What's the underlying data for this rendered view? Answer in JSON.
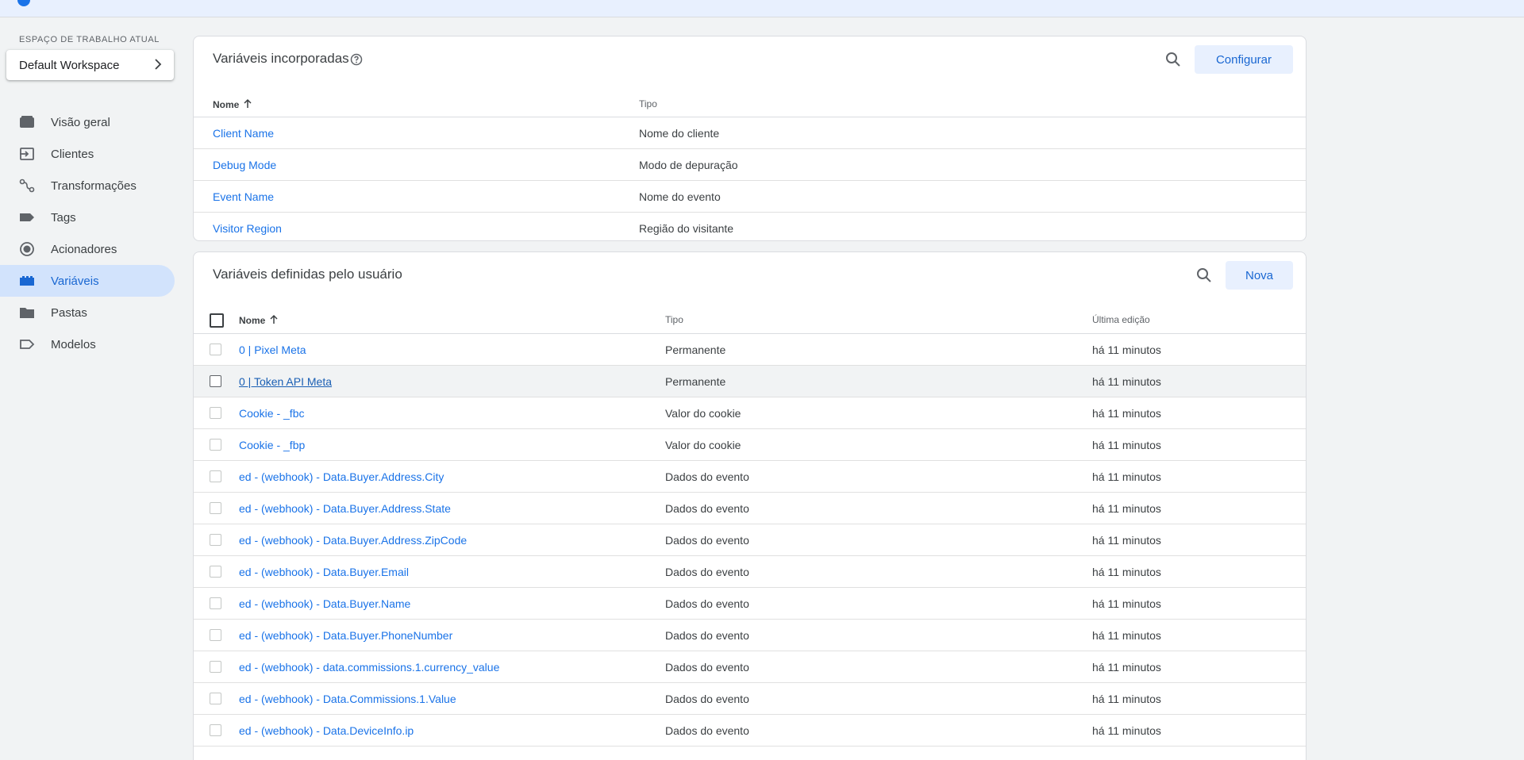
{
  "sidebar": {
    "workspace_label": "ESPAÇO DE TRABALHO ATUAL",
    "workspace_name": "Default Workspace",
    "items": [
      {
        "label": "Visão geral",
        "icon": "overview-icon"
      },
      {
        "label": "Clientes",
        "icon": "clients-icon"
      },
      {
        "label": "Transformações",
        "icon": "transformations-icon"
      },
      {
        "label": "Tags",
        "icon": "tag-icon"
      },
      {
        "label": "Acionadores",
        "icon": "triggers-icon"
      },
      {
        "label": "Variáveis",
        "icon": "variables-icon",
        "active": true
      },
      {
        "label": "Pastas",
        "icon": "folder-icon"
      },
      {
        "label": "Modelos",
        "icon": "templates-icon"
      }
    ]
  },
  "builtin": {
    "title": "Variáveis incorporadas",
    "configure_label": "Configurar",
    "columns": {
      "name": "Nome",
      "type": "Tipo"
    },
    "rows": [
      {
        "name": "Client Name",
        "type": "Nome do cliente"
      },
      {
        "name": "Debug Mode",
        "type": "Modo de depuração"
      },
      {
        "name": "Event Name",
        "type": "Nome do evento"
      },
      {
        "name": "Visitor Region",
        "type": "Região do visitante"
      }
    ]
  },
  "user": {
    "title": "Variáveis definidas pelo usuário",
    "new_label": "Nova",
    "columns": {
      "name": "Nome",
      "type": "Tipo",
      "edited": "Última edição"
    },
    "rows": [
      {
        "name": "0 | Pixel Meta",
        "type": "Permanente",
        "edited": "há 11 minutos"
      },
      {
        "name": "0 | Token API Meta",
        "type": "Permanente",
        "edited": "há 11 minutos"
      },
      {
        "name": "Cookie - _fbc",
        "type": "Valor do cookie",
        "edited": "há 11 minutos"
      },
      {
        "name": "Cookie - _fbp",
        "type": "Valor do cookie",
        "edited": "há 11 minutos"
      },
      {
        "name": "ed - (webhook) - Data.Buyer.Address.City",
        "type": "Dados do evento",
        "edited": "há 11 minutos"
      },
      {
        "name": "ed - (webhook) - Data.Buyer.Address.State",
        "type": "Dados do evento",
        "edited": "há 11 minutos"
      },
      {
        "name": "ed - (webhook) - Data.Buyer.Address.ZipCode",
        "type": "Dados do evento",
        "edited": "há 11 minutos"
      },
      {
        "name": "ed - (webhook) - Data.Buyer.Email",
        "type": "Dados do evento",
        "edited": "há 11 minutos"
      },
      {
        "name": "ed - (webhook) - Data.Buyer.Name",
        "type": "Dados do evento",
        "edited": "há 11 minutos"
      },
      {
        "name": "ed - (webhook) - Data.Buyer.PhoneNumber",
        "type": "Dados do evento",
        "edited": "há 11 minutos"
      },
      {
        "name": "ed - (webhook) - data.commissions.1.currency_value",
        "type": "Dados do evento",
        "edited": "há 11 minutos"
      },
      {
        "name": "ed - (webhook) - Data.Commissions.1.Value",
        "type": "Dados do evento",
        "edited": "há 11 minutos"
      },
      {
        "name": "ed - (webhook) - Data.DeviceInfo.ip",
        "type": "Dados do evento",
        "edited": "há 11 minutos"
      }
    ]
  },
  "colors": {
    "accent": "#1a73e8",
    "active_bg": "#d2e3fc",
    "button_bg": "#e8f0fe"
  }
}
